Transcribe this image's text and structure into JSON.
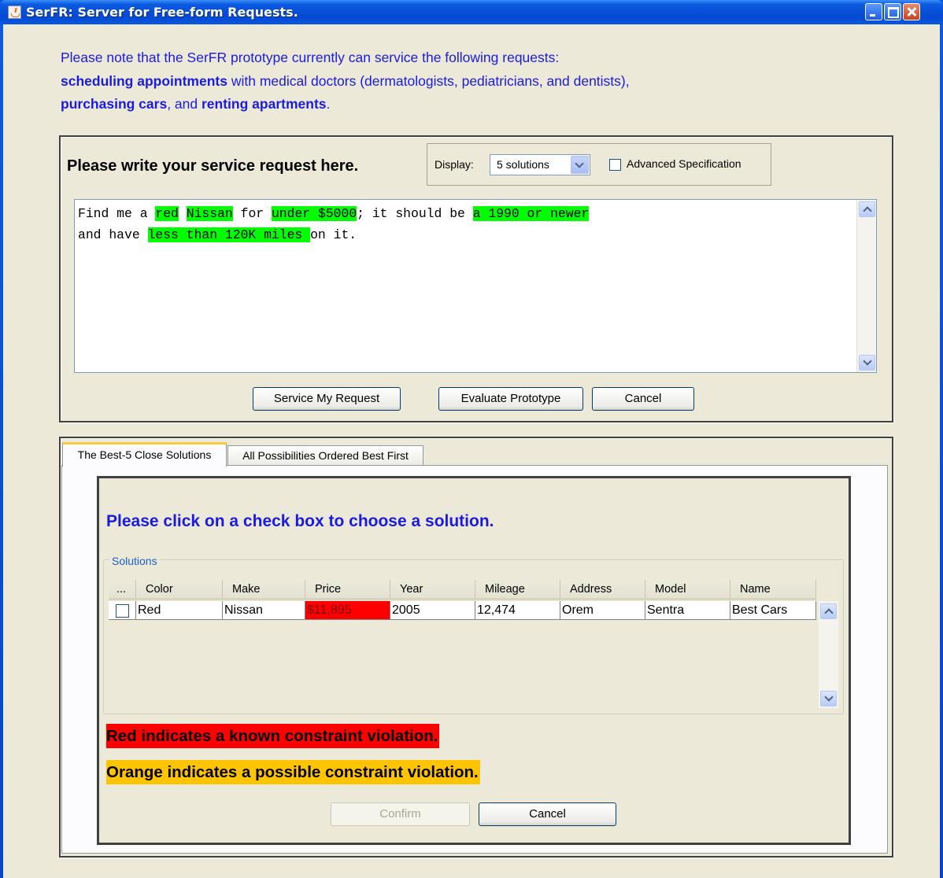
{
  "window": {
    "title": "SerFR: Server for Free-form Requests."
  },
  "notice": {
    "line1": "Please note that the SerFR prototype currently can service the following requests:",
    "line2_bold": "scheduling appointments",
    "line2_rest": " with medical doctors (dermatologists, pediatricians, and dentists),",
    "line3_bold1": "purchasing cars",
    "line3_mid": ", and ",
    "line3_bold2": "renting apartments",
    "line3_end": "."
  },
  "request_panel": {
    "heading": "Please write your service request here.",
    "display_label": "Display:",
    "display_value": "5 solutions",
    "advanced_label": "Advanced Specification",
    "advanced_checked": false,
    "request_lines": [
      [
        {
          "text": "Find me a ",
          "hl": false
        },
        {
          "text": "red",
          "hl": true
        },
        {
          "text": " ",
          "hl": false
        },
        {
          "text": "Nissan",
          "hl": true
        },
        {
          "text": " for ",
          "hl": false
        },
        {
          "text": "under $5000",
          "hl": true
        },
        {
          "text": "; it should be ",
          "hl": false
        },
        {
          "text": "a 1990 or newer",
          "hl": true
        }
      ],
      [
        {
          "text": "and have ",
          "hl": false
        },
        {
          "text": "less than 120K miles ",
          "hl": true
        },
        {
          "text": "on it.",
          "hl": false
        }
      ]
    ],
    "highlight_color": "#00ff00",
    "buttons": {
      "service": "Service My Request",
      "evaluate": "Evaluate Prototype",
      "cancel": "Cancel"
    }
  },
  "tabs": [
    {
      "label": "The Best-5 Close Solutions",
      "active": true
    },
    {
      "label": "All Possibilities Ordered Best First",
      "active": false
    }
  ],
  "solutions_panel": {
    "instruction": "Please click on a check box to choose a solution.",
    "group_label": "Solutions",
    "columns": [
      "...",
      "Color",
      "Make",
      "Price",
      "Year",
      "Mileage",
      "Address",
      "Model",
      "Name"
    ],
    "rows": [
      {
        "checked": false,
        "Color": "Red",
        "Make": "Nissan",
        "Price": "$11,895",
        "Year": "2005",
        "Mileage": "12,474",
        "Address": "Orem",
        "Model": "Sentra",
        "Name": "Best Cars",
        "violations": [
          "Price"
        ]
      }
    ],
    "legend_red": "Red indicates a known constraint violation.",
    "legend_orange": "Orange indicates a possible constraint violation.",
    "violation_color": "#ff0000",
    "possible_violation_color": "#ffc400",
    "buttons": {
      "confirm": "Confirm",
      "confirm_enabled": false,
      "cancel": "Cancel"
    }
  },
  "colors": {
    "notice_text": "#1b1be0",
    "titlebar": "#0b5ae0",
    "client_bg": "#ece9d8"
  }
}
